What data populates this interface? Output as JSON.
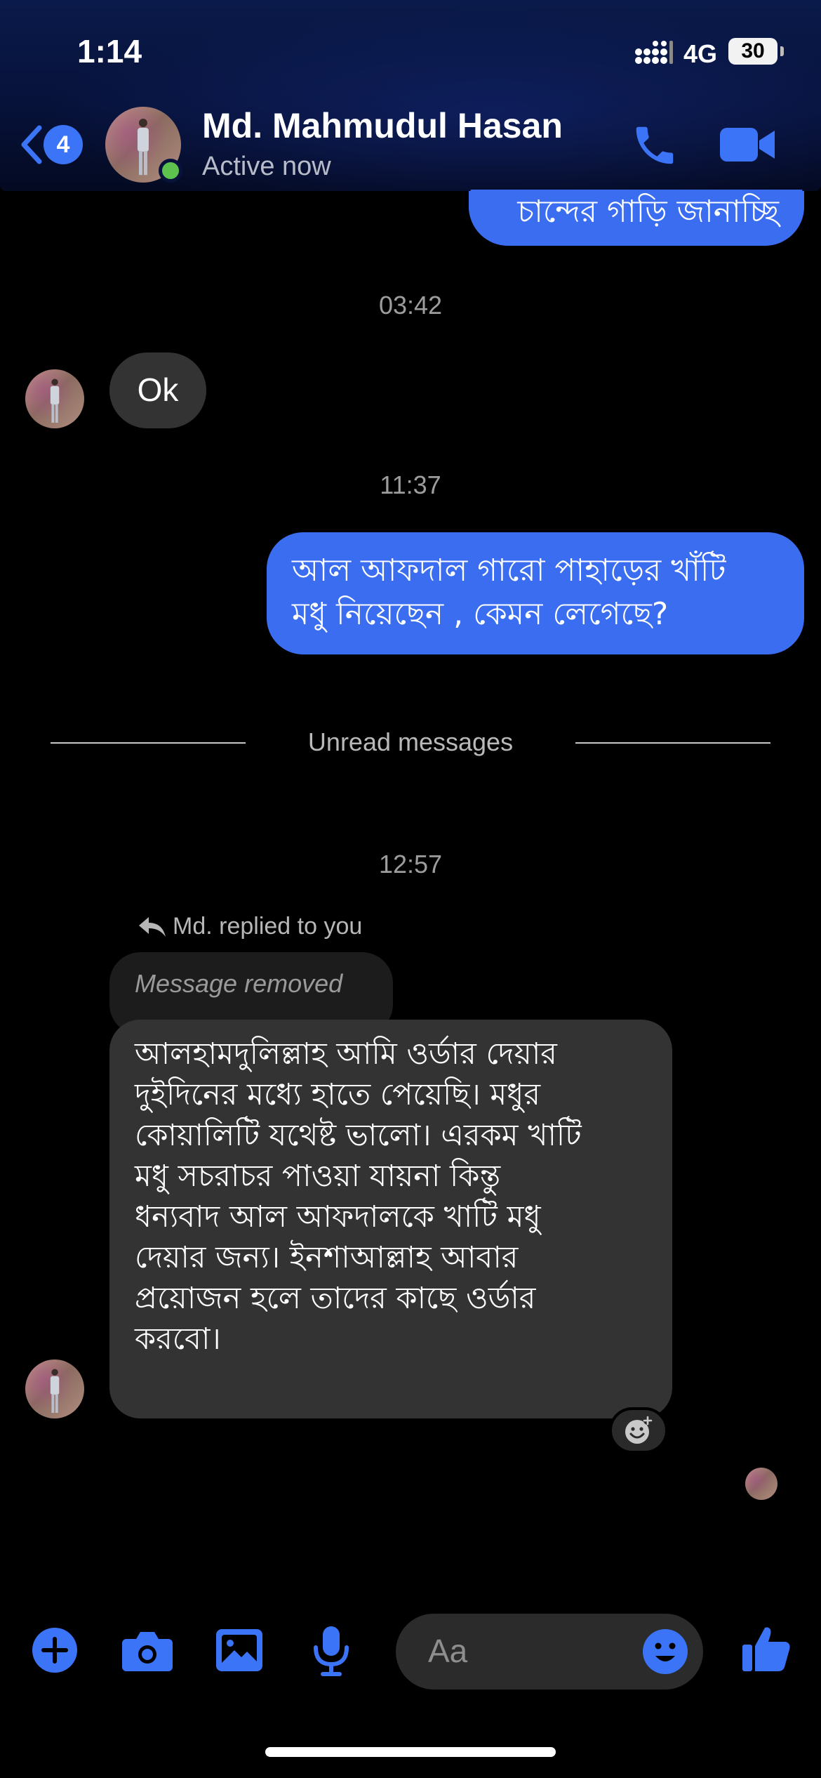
{
  "status_bar": {
    "time": "1:14",
    "network": "4G",
    "battery": "30"
  },
  "header": {
    "back_badge": "4",
    "contact_name": "Md. Mahmudul Hasan",
    "contact_status": "Active now"
  },
  "messages": {
    "top_partial": "চান্দের গাড়ি জানাচ্ছি",
    "time_1": "03:42",
    "incoming_ok": "Ok",
    "time_2": "11:37",
    "outgoing_line1": "আল আফদাল গারো পাহাড়ের খাঁটি",
    "outgoing_line2": "মধু নিয়েছেন , কেমন লেগেছে?",
    "unread_divider": "Unread messages",
    "time_3": "12:57",
    "replied_label": "Md. replied to you",
    "removed_text": "Message removed",
    "long_lines": [
      "আলহামদুলিল্লাহ আমি ওর্ডার দেয়ার",
      "দুইদিনের মধ্যে হাতে পেয়েছি। মধুর",
      "কোয়ালিটি যথেষ্ট ভালো। এরকম খাটি",
      "মধু সচরাচর পাওয়া যায়না কিন্তু",
      "ধন্যবাদ আল আফদালকে খাটি মধু",
      "দেয়ার জন্য। ইনশাআল্লাহ আবার",
      "প্রয়োজন হলে তাদের কাছে ওর্ডার",
      "করবো।"
    ]
  },
  "composer": {
    "placeholder": "Aa"
  },
  "icons": {
    "back": "chevron-left-icon",
    "call": "phone-icon",
    "video": "video-camera-icon",
    "plus": "plus-icon",
    "camera": "camera-icon",
    "gallery": "image-icon",
    "mic": "microphone-icon",
    "emoji": "smiley-icon",
    "like": "thumbs-up-icon",
    "reply": "reply-arrow-icon",
    "react": "add-reaction-icon"
  },
  "colors": {
    "accent": "#3a6df0",
    "online": "#5ec24f",
    "incoming_bubble": "#333333"
  }
}
